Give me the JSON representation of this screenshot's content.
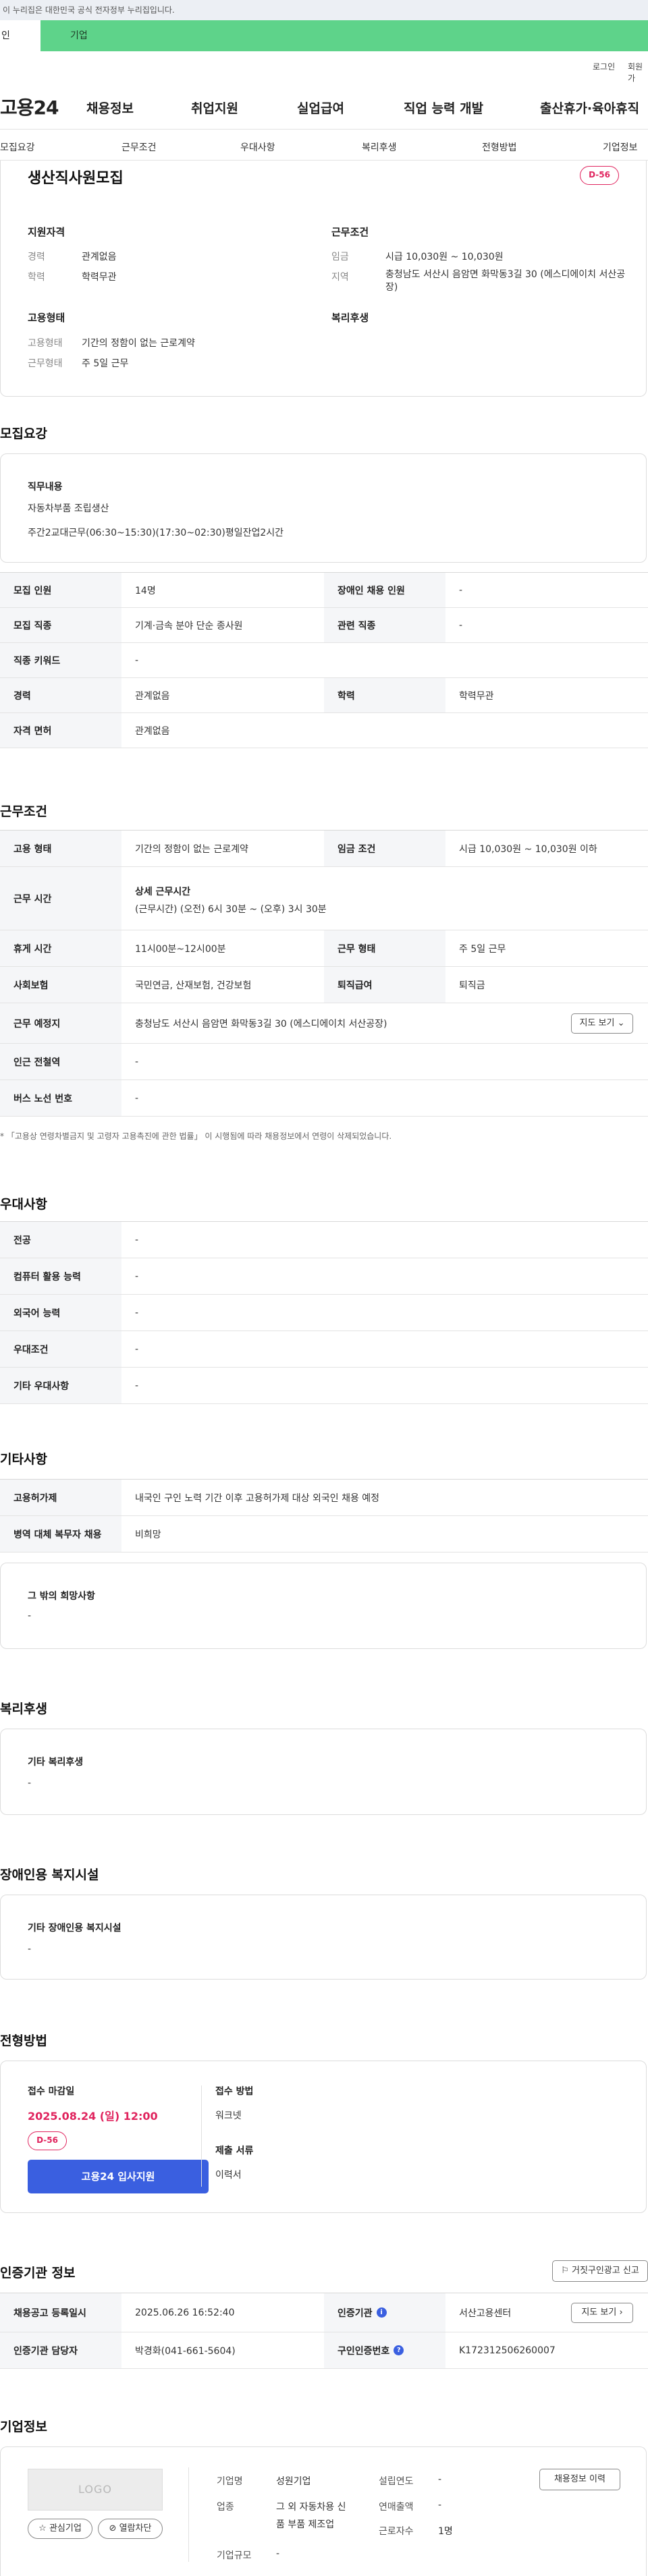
{
  "top_notice": "이 누리집은 대한민국 공식 전자정부 누리집입니다.",
  "tabs": {
    "personal": "인",
    "company": "기업"
  },
  "util": {
    "login": "로그인",
    "signup": "회원가"
  },
  "gnb": {
    "logo": "고용24",
    "menu": [
      "채용정보",
      "취업지원",
      "실업급여",
      "직업 능력 개발",
      "출산휴가·육아휴직"
    ]
  },
  "subnav": [
    "모집요강",
    "근무조건",
    "우대사항",
    "복리후생",
    "전형방법",
    "기업정보"
  ],
  "summary": {
    "title": "생산직사원모집",
    "dday": "D-56",
    "qual_title": "지원자격",
    "qual": [
      {
        "k": "경력",
        "v": "관계없음"
      },
      {
        "k": "학력",
        "v": "학력무관"
      }
    ],
    "cond_title": "근무조건",
    "cond": [
      {
        "k": "임금",
        "v": "시급 10,030원 ~ 10,030원"
      },
      {
        "k": "지역",
        "v": "충청남도 서산시 음암면 화막동3길 30 (에스디에이치 서산공장)"
      }
    ],
    "emp_title": "고용형태",
    "emp": [
      {
        "k": "고용형태",
        "v": "기간의 정함이 없는 근로계약"
      },
      {
        "k": "근무형태",
        "v": "주 5일 근무"
      }
    ],
    "welfare_title": "복리후생"
  },
  "recruit": {
    "title": "모집요강",
    "duty_label": "직무내용",
    "duty_lines": [
      "자동차부품 조립생산",
      "주간2교대근무(06:30~15:30)(17:30~02:30)평일잔업2시간"
    ],
    "rows": [
      {
        "k1": "모집 인원",
        "v1": "14명",
        "k2": "장애인 채용 인원",
        "v2": "-"
      },
      {
        "k1": "모집 직종",
        "v1": "기계·금속 분야 단순 종사원",
        "k2": "관련 직종",
        "v2": "-"
      },
      {
        "k1": "직종 키워드",
        "v1": "-"
      },
      {
        "k1": "경력",
        "v1": "관계없음",
        "k2": "학력",
        "v2": "학력무관"
      },
      {
        "k1": "자격 면허",
        "v1": "관계없음"
      }
    ]
  },
  "work": {
    "title": "근무조건",
    "r1": {
      "k1": "고용 형태",
      "v1": "기간의 정함이 없는 근로계약",
      "k2": "임금 조건",
      "v2": "시급 10,030원 ~ 10,030원 이하"
    },
    "r2": {
      "k": "근무 시간",
      "head": "상세 근무시간",
      "detail": "(근무시간) (오전) 6시 30분 ~ (오후) 3시 30분"
    },
    "r3": {
      "k1": "휴게 시간",
      "v1": "11시00분~12시00분",
      "k2": "근무 형태",
      "v2": "주 5일 근무"
    },
    "r4": {
      "k1": "사회보험",
      "v1": "국민연금, 산재보험, 건강보험",
      "k2": "퇴직급여",
      "v2": "퇴직금"
    },
    "r5": {
      "k": "근무 예정지",
      "v": "충청남도 서산시 음암면 화막동3길 30 (에스디에이치 서산공장)",
      "btn": "지도 보기"
    },
    "r6": {
      "k": "인근 전철역",
      "v": "-"
    },
    "r7": {
      "k": "버스 노선 번호",
      "v": "-"
    },
    "note": "* 「고용상 연령차별금지 및 고령자 고용촉진에 관한 법률」 이 시행됨에 따라 채용정보에서 연령이 삭제되었습니다."
  },
  "pref": {
    "title": "우대사항",
    "rows": [
      {
        "k": "전공",
        "v": "-"
      },
      {
        "k": "컴퓨터 활용 능력",
        "v": "-"
      },
      {
        "k": "외국어 능력",
        "v": "-"
      },
      {
        "k": "우대조건",
        "v": "-"
      },
      {
        "k": "기타 우대사항",
        "v": "-"
      }
    ]
  },
  "etc": {
    "title": "기타사항",
    "rows": [
      {
        "k": "고용허가제",
        "v": "내국인 구인 노력 기간 이후 고용허가제 대상 외국인 채용 예정"
      },
      {
        "k": "병역 대체 복무자 채용",
        "v": "비희망"
      }
    ],
    "other_label": "그 밖의 희망사항",
    "other_value": "-"
  },
  "welfare": {
    "title": "복리후생",
    "label": "기타 복리후생",
    "value": "-"
  },
  "disabled": {
    "title": "장애인용 복지시설",
    "label": "기타 장애인용 복지시설",
    "value": "-"
  },
  "selection": {
    "title": "전형방법",
    "deadline_label": "접수 마감일",
    "deadline": "2025.08.24 (일) 12:00",
    "dday": "D-56",
    "apply_btn": "고용24 입사지원",
    "method_label": "접수 방법",
    "method_value": "워크넷",
    "docs_label": "제출 서류",
    "docs_value": "이력서"
  },
  "cert": {
    "title": "인증기관 정보",
    "report_btn": "거짓구인광고 신고",
    "r1": {
      "k1": "채용공고 등록일시",
      "v1": "2025.06.26 16:52:40",
      "k2": "인증기관",
      "v2": "서산고용센터",
      "btn": "지도 보기"
    },
    "r2": {
      "k1": "인증기관 담당자",
      "v1": "박경화(041-661-5604)",
      "k2": "구인인증번호",
      "v2": "K172312506260007"
    }
  },
  "company": {
    "title": "기업정보",
    "logo_text": "LOGO",
    "fav_btn": "관심기업",
    "block_btn": "열람차단",
    "fields": [
      {
        "k": "기업명",
        "v": "성원기업"
      },
      {
        "k": "업종",
        "v": "그 외 자동차용 신품 부품 제조업"
      },
      {
        "k": "기업규모",
        "v": "-"
      }
    ],
    "fields2": [
      {
        "k": "설립연도",
        "v": "-"
      },
      {
        "k": "연매출액",
        "v": "-"
      },
      {
        "k": "근로자수",
        "v": "1명"
      }
    ],
    "history_btn": "채용정보 이력"
  }
}
